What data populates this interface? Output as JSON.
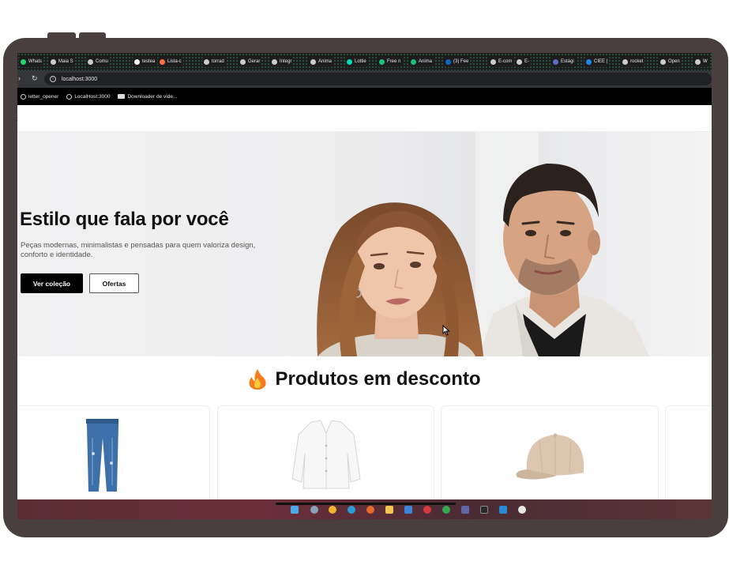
{
  "browser": {
    "tabs": [
      {
        "label": "Whats",
        "color": "#25d366"
      },
      {
        "label": "Maia S",
        "color": "#cccccc"
      },
      {
        "label": "Comu",
        "color": "#cccccc"
      },
      {
        "label": "testea",
        "color": "#f5f5f5"
      },
      {
        "label": "Lista-c",
        "color": "#ff7043"
      },
      {
        "label": "torrad",
        "color": "#cccccc"
      },
      {
        "label": "Gerar",
        "color": "#cccccc"
      },
      {
        "label": "Integr",
        "color": "#cccccc"
      },
      {
        "label": "Anima",
        "color": "#cccccc"
      },
      {
        "label": "Lottie",
        "color": "#00ddb3"
      },
      {
        "label": "Free n",
        "color": "#19c37d"
      },
      {
        "label": "Anima",
        "color": "#19c37d"
      },
      {
        "label": "(3) Fee",
        "color": "#0a66c2"
      },
      {
        "label": "E-com",
        "color": "#cccccc"
      },
      {
        "label": "E-",
        "color": "#cccccc"
      },
      {
        "label": "Estági",
        "color": "#5c6bc0"
      },
      {
        "label": "CIEE |",
        "color": "#1e88e5"
      },
      {
        "label": "rocket",
        "color": "#cccccc"
      },
      {
        "label": "Open",
        "color": "#cccccc"
      },
      {
        "label": "W",
        "color": "#cccccc"
      }
    ],
    "url": "localhost:3000",
    "bookmarks": [
      {
        "label": "letter_opener",
        "icon": "globe-icon"
      },
      {
        "label": "LocalHost:3000",
        "icon": "globe-icon"
      },
      {
        "label": "Downloader de vide...",
        "icon": "youtube-icon"
      }
    ]
  },
  "hero": {
    "title": "Estilo que fala por você",
    "subtitle": "Peças modernas, minimalistas e pensadas para quem valoriza design, conforto e identidade.",
    "primary_button": "Ver coleção",
    "secondary_button": "Ofertas"
  },
  "discount_section": {
    "icon": "fire-icon",
    "title": "Produtos em desconto",
    "products": [
      {
        "name": "jeans",
        "image": "jeans-image"
      },
      {
        "name": "blouse",
        "image": "white-blouse-image"
      },
      {
        "name": "cap",
        "image": "beige-cap-image"
      }
    ]
  },
  "colors": {
    "tablet_frame": "#4a3f3f",
    "primary_button": "#000000",
    "text": "#111111"
  }
}
